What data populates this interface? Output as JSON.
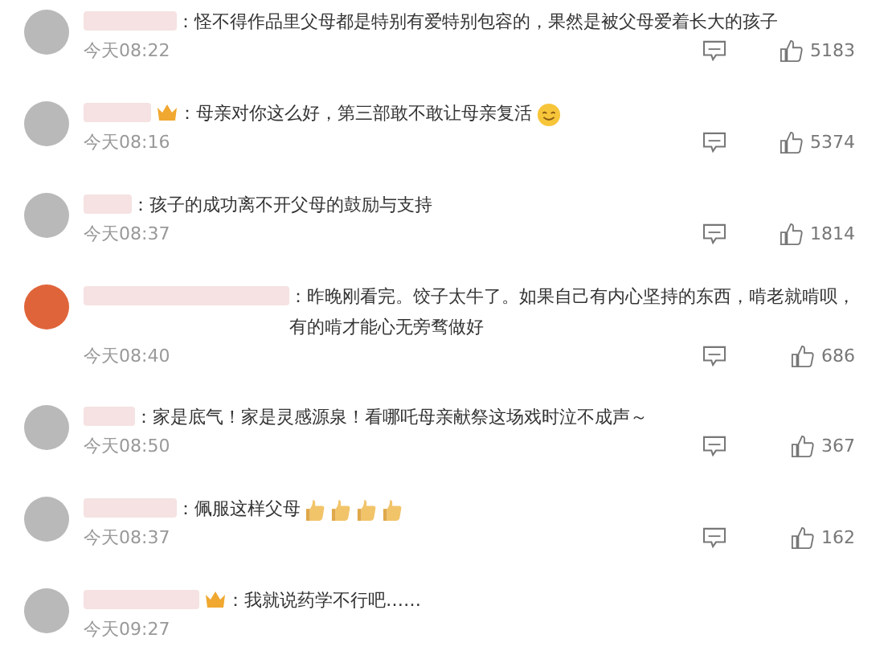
{
  "comments": [
    {
      "text": "：怪不得作品里父母都是特别有爱特别包容的，果然是被父母爱着长大的孩子",
      "time": "今天08:22",
      "likes": "5183"
    },
    {
      "crown": true,
      "text": "：母亲对你这么好，第三部敢不敢让母亲复活",
      "emoji": [
        {
          "kind": "smile"
        }
      ],
      "time": "今天08:16",
      "likes": "5374"
    },
    {
      "text": "：孩子的成功离不开父母的鼓励与支持",
      "time": "今天08:37",
      "likes": "1814"
    },
    {
      "text": "：昨晚刚看完。饺子太牛了。如果自己有内心坚持的东西，啃老就啃呗，有的啃才能心无旁骛做好",
      "time": "今天08:40",
      "likes": "686"
    },
    {
      "text": "：家是底气！家是灵感源泉！看哪吒母亲献祭这场戏时泣不成声～",
      "time": "今天08:50",
      "likes": "367"
    },
    {
      "text": "：佩服这样父母",
      "emoji": [
        {
          "kind": "thumbs"
        },
        {
          "kind": "thumbs"
        },
        {
          "kind": "thumbs"
        },
        {
          "kind": "thumbs"
        }
      ],
      "time": "今天08:37",
      "likes": "162"
    },
    {
      "crown": true,
      "text": "：我就说药学不行吧……",
      "time": "今天09:27"
    }
  ]
}
